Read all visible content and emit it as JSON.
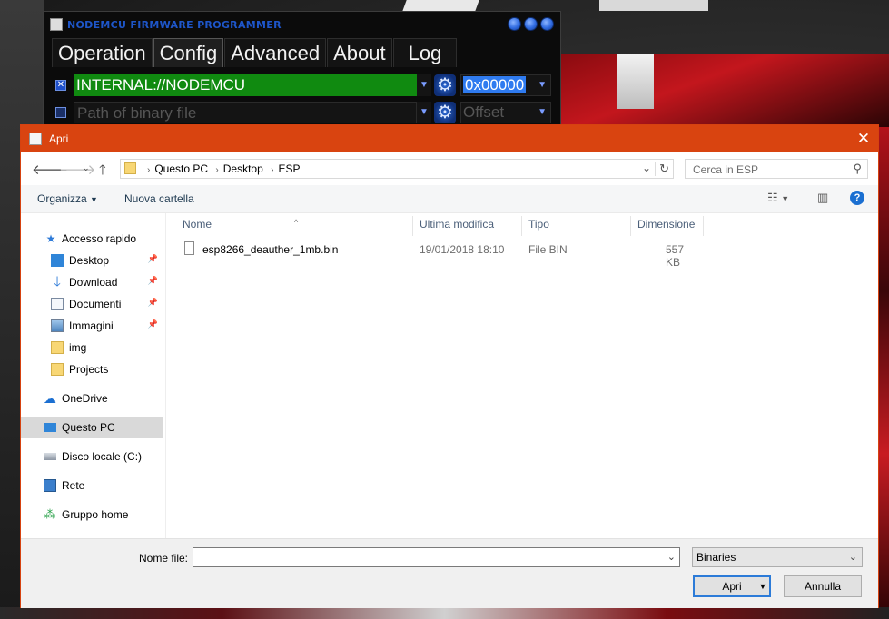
{
  "nodemcu": {
    "title": "NODEMCU FIRMWARE PROGRAMMER",
    "tabs": [
      "Operation",
      "Config",
      "Advanced",
      "About",
      "Log"
    ],
    "active_tab": "Config",
    "rows": [
      {
        "checked": true,
        "path": "INTERNAL://NODEMCU",
        "address": "0x00000"
      },
      {
        "checked": false,
        "path_placeholder": "Path of binary file",
        "address_placeholder": "Offset"
      }
    ]
  },
  "dialog": {
    "title": "Apri",
    "close_symbol": "✕",
    "breadcrumb": [
      "Questo PC",
      "Desktop",
      "ESP"
    ],
    "search_placeholder": "Cerca in ESP",
    "toolbar": {
      "organize": "Organizza",
      "new_folder": "Nuova cartella"
    },
    "nav": {
      "quick_access": "Accesso rapido",
      "items": [
        {
          "label": "Desktop",
          "pinned": true,
          "icon": "desktop-icon"
        },
        {
          "label": "Download",
          "pinned": true,
          "icon": "download-icon"
        },
        {
          "label": "Documenti",
          "pinned": true,
          "icon": "documents-icon"
        },
        {
          "label": "Immagini",
          "pinned": true,
          "icon": "pictures-icon"
        },
        {
          "label": "img",
          "pinned": false,
          "icon": "folder-icon"
        },
        {
          "label": "Projects",
          "pinned": false,
          "icon": "folder-icon"
        }
      ],
      "onedrive": "OneDrive",
      "this_pc": "Questo PC",
      "local_disk": "Disco locale (C:)",
      "network": "Rete",
      "homegroup": "Gruppo home"
    },
    "columns": {
      "name": "Nome",
      "modified": "Ultima modifica",
      "type": "Tipo",
      "size": "Dimensione"
    },
    "files": [
      {
        "name": "esp8266_deauther_1mb.bin",
        "modified": "19/01/2018 18:10",
        "type": "File BIN",
        "size": "557 KB"
      }
    ],
    "filename_label": "Nome file:",
    "filename_value": "",
    "filter": "Binaries",
    "open_button": "Apri",
    "cancel_button": "Annulla"
  },
  "colors": {
    "dialog_titlebar": "#d94410",
    "nodemcu_title": "#1e56c9",
    "path_green": "#108a10",
    "accent": "#2c7bd8"
  }
}
